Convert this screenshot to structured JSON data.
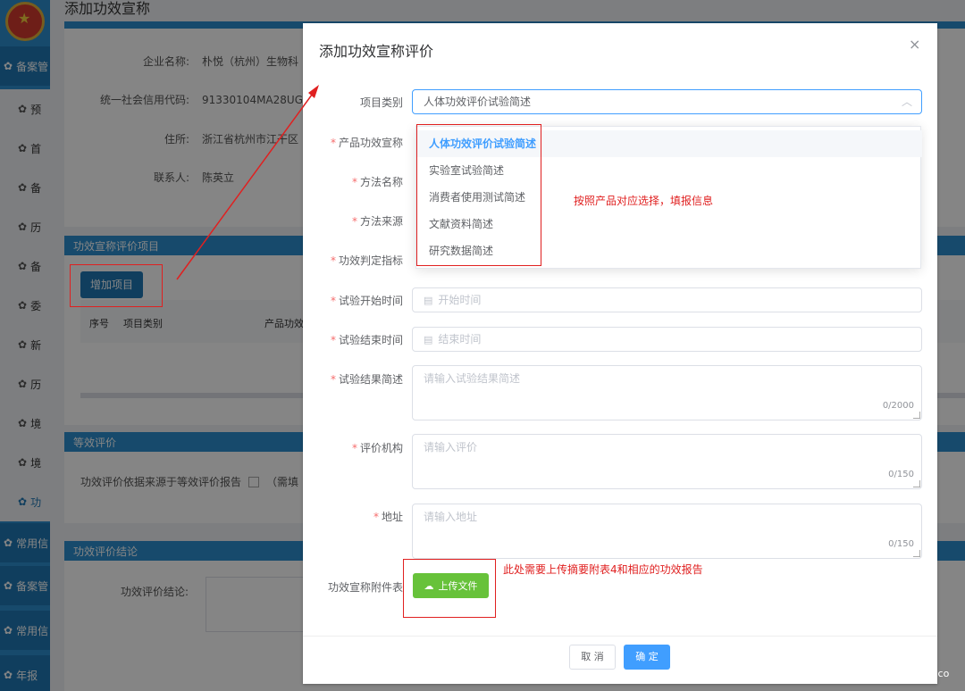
{
  "background": {
    "page_title": "添加功效宣称",
    "nav": {
      "top_items": [
        "备案管",
        "常用信",
        "备案管",
        "常用信",
        "年报"
      ],
      "sub_items": [
        "预",
        "首",
        "备",
        "历",
        "备",
        "委",
        "新",
        "历",
        "境",
        "境",
        "功"
      ]
    },
    "info": [
      {
        "label": "企业名称:",
        "value": "朴悦（杭州）生物科"
      },
      {
        "label": "统一社会信用代码:",
        "value": "91330104MA28UGI"
      },
      {
        "label": "住所:",
        "value": "浙江省杭州市江干区"
      },
      {
        "label": "联系人:",
        "value": "陈英立"
      }
    ],
    "section_eval": "功效宣称评价项目",
    "add_button": "增加项目",
    "table_headers": [
      "序号",
      "项目类别",
      "产品功效"
    ],
    "section_equal": "等效评价",
    "equal_text": "功效评价依据来源于等效评价报告",
    "equal_hint": "（需填",
    "section_conclusion": "功效评价结论",
    "conclusion_label": "功效评价结论:"
  },
  "dialog": {
    "title": "添加功效宣称评价",
    "close": "×",
    "fields": {
      "category": {
        "label": "项目类别",
        "value": "人体功效评价试验简述"
      },
      "claim": {
        "label": "产品功效宣称"
      },
      "method_name": {
        "label": "方法名称"
      },
      "method_source": {
        "label": "方法来源"
      },
      "indicator": {
        "label": "功效判定指标"
      },
      "start": {
        "label": "试验开始时间",
        "placeholder": "开始时间"
      },
      "end": {
        "label": "试验结束时间",
        "placeholder": "结束时间"
      },
      "result": {
        "label": "试验结果简述",
        "placeholder": "请输入试验结果简述",
        "count": "0/2000"
      },
      "org": {
        "label": "评价机构",
        "placeholder": "请输入评价",
        "count": "0/150"
      },
      "address": {
        "label": "地址",
        "placeholder": "请输入地址",
        "count": "0/150"
      },
      "attach": {
        "label": "功效宣称附件表"
      }
    },
    "required_mark": "*",
    "dropdown_options": [
      "人体功效评价试验简述",
      "实验室试验简述",
      "消费者使用测试简述",
      "文献资料简述",
      "研究数据简述"
    ],
    "upload_button": "上传文件",
    "cancel": "取 消",
    "ok": "确 定"
  },
  "annotations": {
    "select_note": "按照产品对应选择，填报信息",
    "upload_note": "此处需要上传摘要附表4和相应的功效报告"
  },
  "watermark": "c.co"
}
